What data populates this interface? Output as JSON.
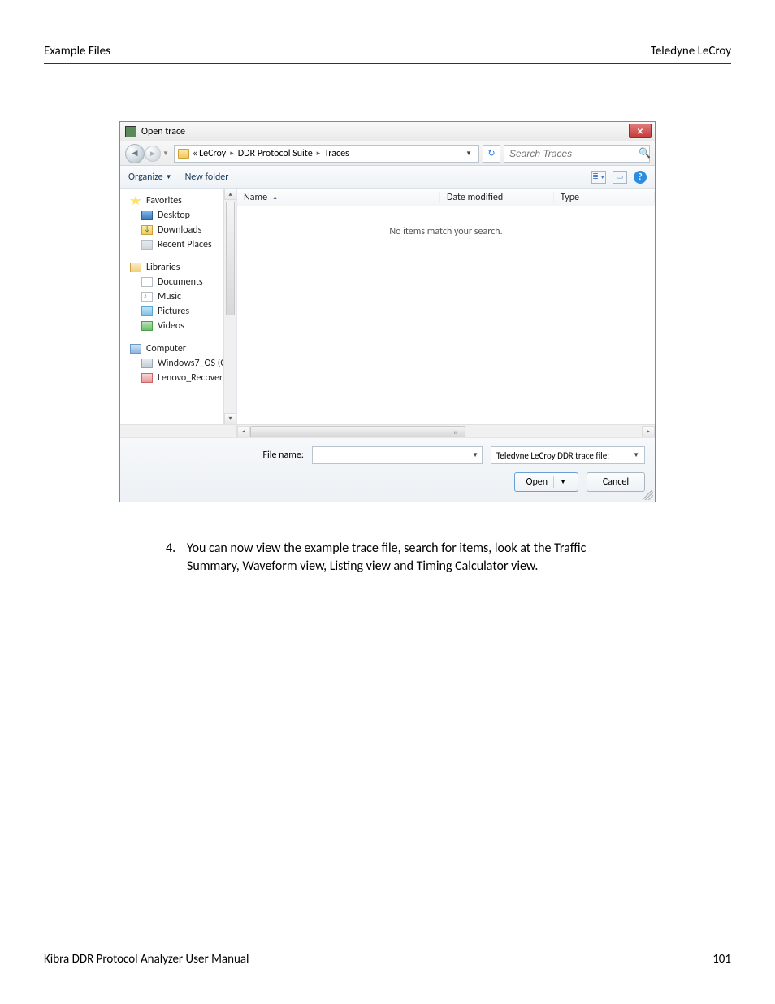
{
  "page": {
    "header_left": "Example Files",
    "header_right": "Teledyne LeCroy",
    "footer_left": "Kibra DDR Protocol Analyzer User Manual",
    "footer_right": "101"
  },
  "dialog": {
    "title": "Open trace",
    "close_glyph": "✕",
    "breadcrumb": {
      "prefix": "«",
      "seg1": "LeCroy",
      "seg2": "DDR Protocol Suite",
      "seg3": "Traces"
    },
    "refresh_glyph": "↻",
    "search_placeholder": "Search Traces",
    "toolbar": {
      "organize": "Organize",
      "new_folder": "New folder",
      "views_glyph": "≣",
      "preview_glyph": "▭"
    },
    "sidebar": {
      "favorites": "Favorites",
      "desktop": "Desktop",
      "downloads": "Downloads",
      "recent": "Recent Places",
      "libraries": "Libraries",
      "documents": "Documents",
      "music": "Music",
      "pictures": "Pictures",
      "videos": "Videos",
      "computer": "Computer",
      "drive1": "Windows7_OS (C",
      "drive2": "Lenovo_Recover"
    },
    "columns": {
      "name": "Name",
      "date": "Date modified",
      "type": "Type"
    },
    "empty": "No items match your search.",
    "hscroll_mark": "ııı",
    "file_name_label": "File name:",
    "filter": "Teledyne LeCroy DDR trace file:",
    "open": "Open",
    "cancel": "Cancel"
  },
  "instruction": {
    "num": "4.",
    "text_a": "You can now view the example trace file, search for items, look at the Traffic",
    "text_b": "Summary, Waveform view, Listing view and Timing Calculator view."
  }
}
